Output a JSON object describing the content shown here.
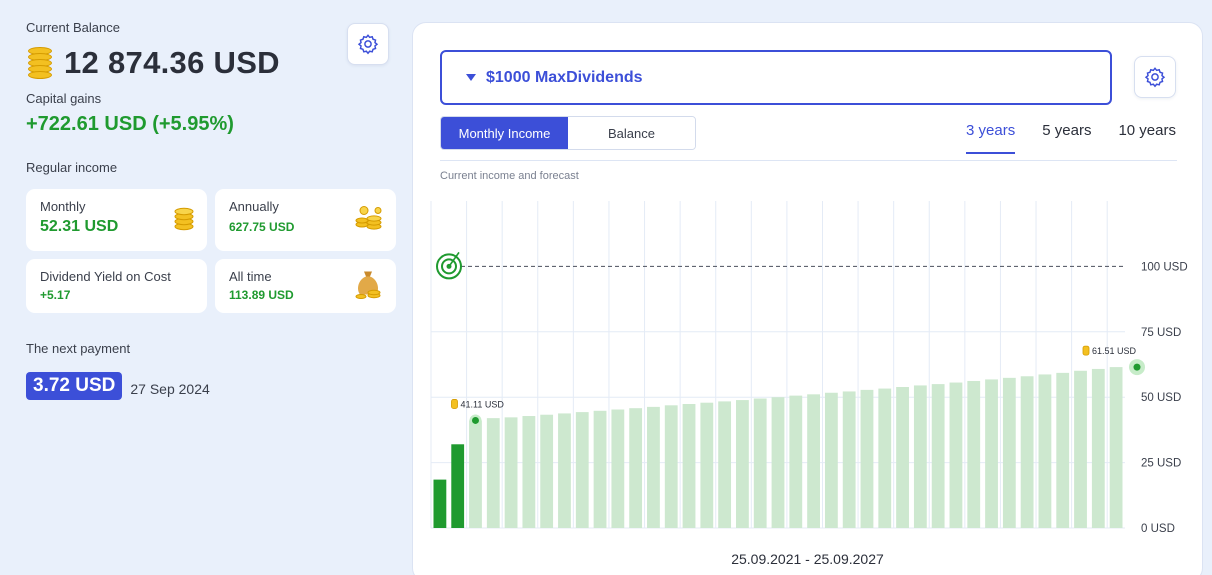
{
  "left": {
    "balance_label": "Current Balance",
    "balance_value": "12 874.36 USD",
    "gains_label": "Capital gains",
    "gains_value": "+722.61 USD (+5.95%)",
    "regular_income_label": "Regular income",
    "cards": {
      "monthly": {
        "title": "Monthly",
        "value": "52.31 USD",
        "icon": "coin-stack-icon"
      },
      "annually": {
        "title": "Annually",
        "value": "627.75 USD",
        "icon": "coins-pile-icon"
      },
      "yield": {
        "title": "Dividend Yield on Cost",
        "value": "+5.17"
      },
      "alltime": {
        "title": "All time",
        "value": "113.89 USD",
        "icon": "money-bag-icon"
      }
    },
    "next_payment_label": "The next payment",
    "next_payment_value": "3.72 USD",
    "next_payment_date": "27 Sep 2024"
  },
  "right": {
    "portfolio_name": "$1000 MaxDividends",
    "segments": {
      "monthly_income": "Monthly Income",
      "balance": "Balance"
    },
    "tabs": {
      "t3": "3 years",
      "t5": "5 years",
      "t10": "10 years"
    },
    "active_tab": "3 years",
    "caption": "Current income and forecast",
    "date_range": "25.09.2021 - 25.09.2027"
  },
  "colors": {
    "accent": "#3c4fd8",
    "positive": "#1f9a2f",
    "forecast_bar": "#cde8cf",
    "actual_bar": "#1f9a2f"
  },
  "chart_data": {
    "type": "bar",
    "ylim": [
      0,
      125
    ],
    "y_ticks": [
      0,
      25,
      50,
      75,
      100
    ],
    "y_tick_labels": [
      "0 USD",
      "25 USD",
      "50 USD",
      "75 USD",
      "100 USD"
    ],
    "target_value": 100,
    "target_label": "100 USD",
    "series": [
      {
        "values": [
          18.5,
          32
        ]
      },
      {
        "values": [
          41.11,
          42,
          42.3,
          42.8,
          43.3,
          43.8,
          44.3,
          44.8,
          45.3,
          45.8,
          46.3,
          46.9,
          47.4,
          47.9,
          48.4,
          48.9,
          49.5,
          50,
          50.6,
          51.1,
          51.7,
          52.2,
          52.8,
          53.3,
          53.9,
          54.5,
          55,
          55.6,
          56.2,
          56.8,
          57.4,
          58,
          58.7,
          59.3,
          60.1,
          60.8,
          61.51
        ]
      }
    ],
    "annotations": [
      {
        "label": "41.11 USD",
        "value": 41.11,
        "bar_index": 2
      },
      {
        "label": "61.51 USD",
        "value": 61.51,
        "bar_index": 38
      }
    ],
    "grid": true
  }
}
